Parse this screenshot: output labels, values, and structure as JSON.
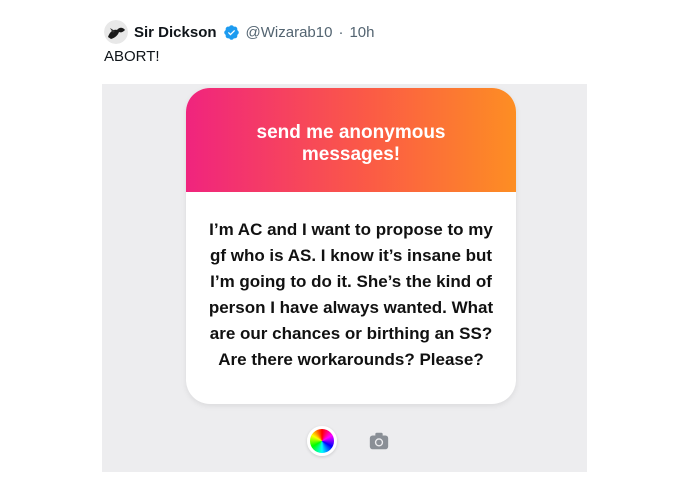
{
  "tweet": {
    "author_name": "Sir Dickson",
    "handle": "@Wizarab10",
    "separator": "·",
    "time": "10h",
    "text": "ABORT!"
  },
  "media": {
    "card_title": "send me anonymous messages!",
    "card_message": "I’m AC and I want to propose to my gf who is AS. I know it’s insane but I’m going to do it. She’s the kind of person I have always wanted. What are our chances or birthing an SS? Are there workarounds? Please?",
    "icons": [
      "color-wheel-icon",
      "camera-icon"
    ]
  },
  "colors": {
    "gradient_start": "#f0247e",
    "gradient_end": "#fd8e23",
    "verified_badge": "#1d9bf0",
    "media_background": "#ededef"
  }
}
